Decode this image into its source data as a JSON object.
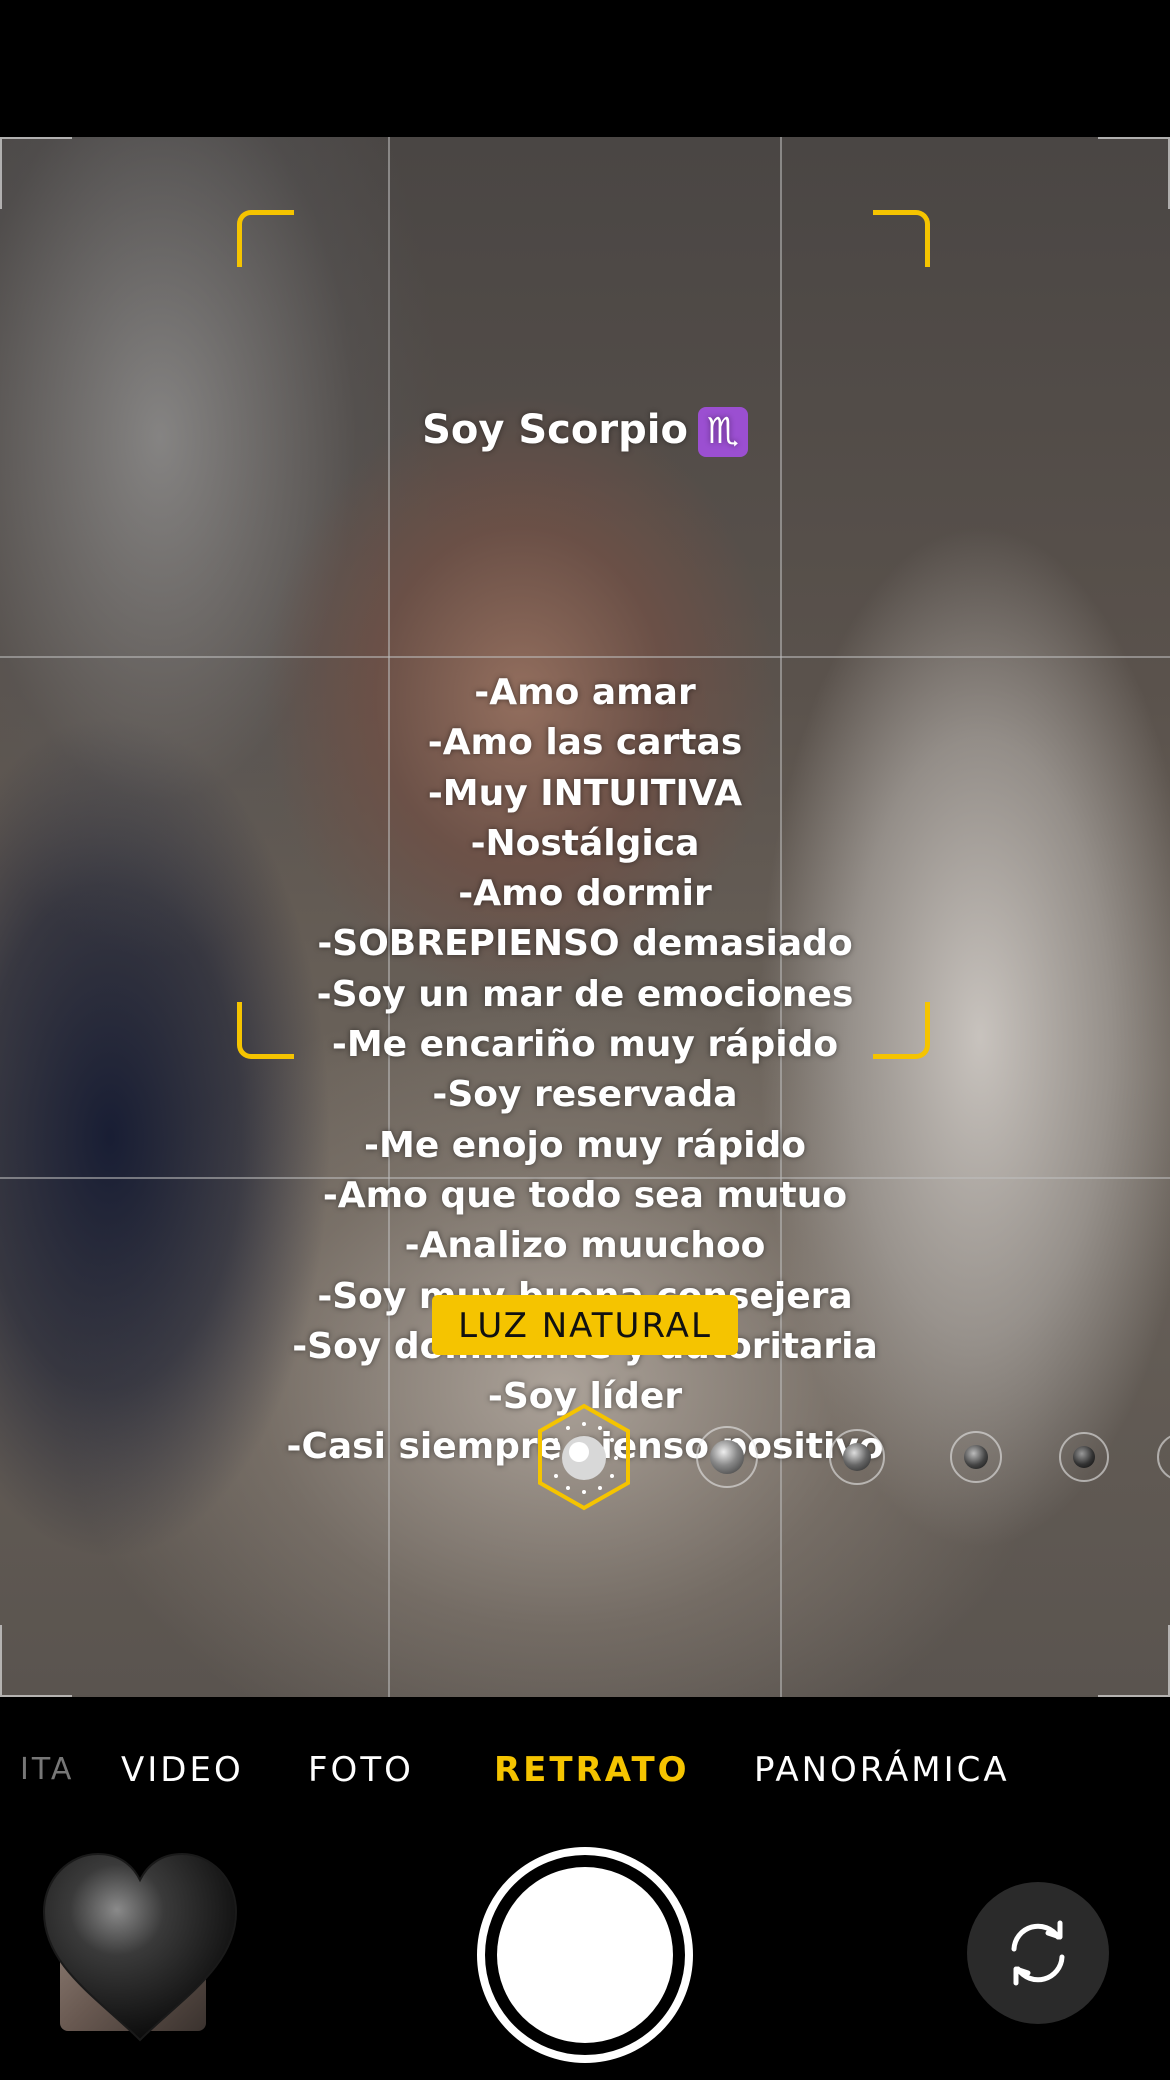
{
  "overlay": {
    "title": "Soy Scorpio",
    "sign_symbol": "♏",
    "traits": [
      "-Amo amar",
      "-Amo las cartas",
      "-Muy INTUITIVA",
      "-Nostálgica",
      "-Amo dormir",
      "-SOBREPIENSO demasiado",
      "-Soy un mar de emociones",
      "-Me encariño muy rápido",
      "-Soy reservada",
      "-Me enojo muy rápido",
      "-Amo que todo sea mutuo",
      "-Analizo muuchoo",
      "-Soy muy buena consejera",
      "-Soy dominante y autoritaria",
      "-Soy líder",
      "-Casi siempre pienso positivo"
    ]
  },
  "camera": {
    "lighting_label": "LUZ NATURAL",
    "modes": {
      "partial": "ITA",
      "video": "VIDEO",
      "photo": "FOTO",
      "portrait": "RETRATO",
      "panoramic": "PANORÁMICA"
    },
    "active_mode": "RETRATO",
    "accent_color": "#f5c400"
  },
  "icons": {
    "gallery_sticker": "black-heart",
    "flip": "flip-camera-icon"
  }
}
